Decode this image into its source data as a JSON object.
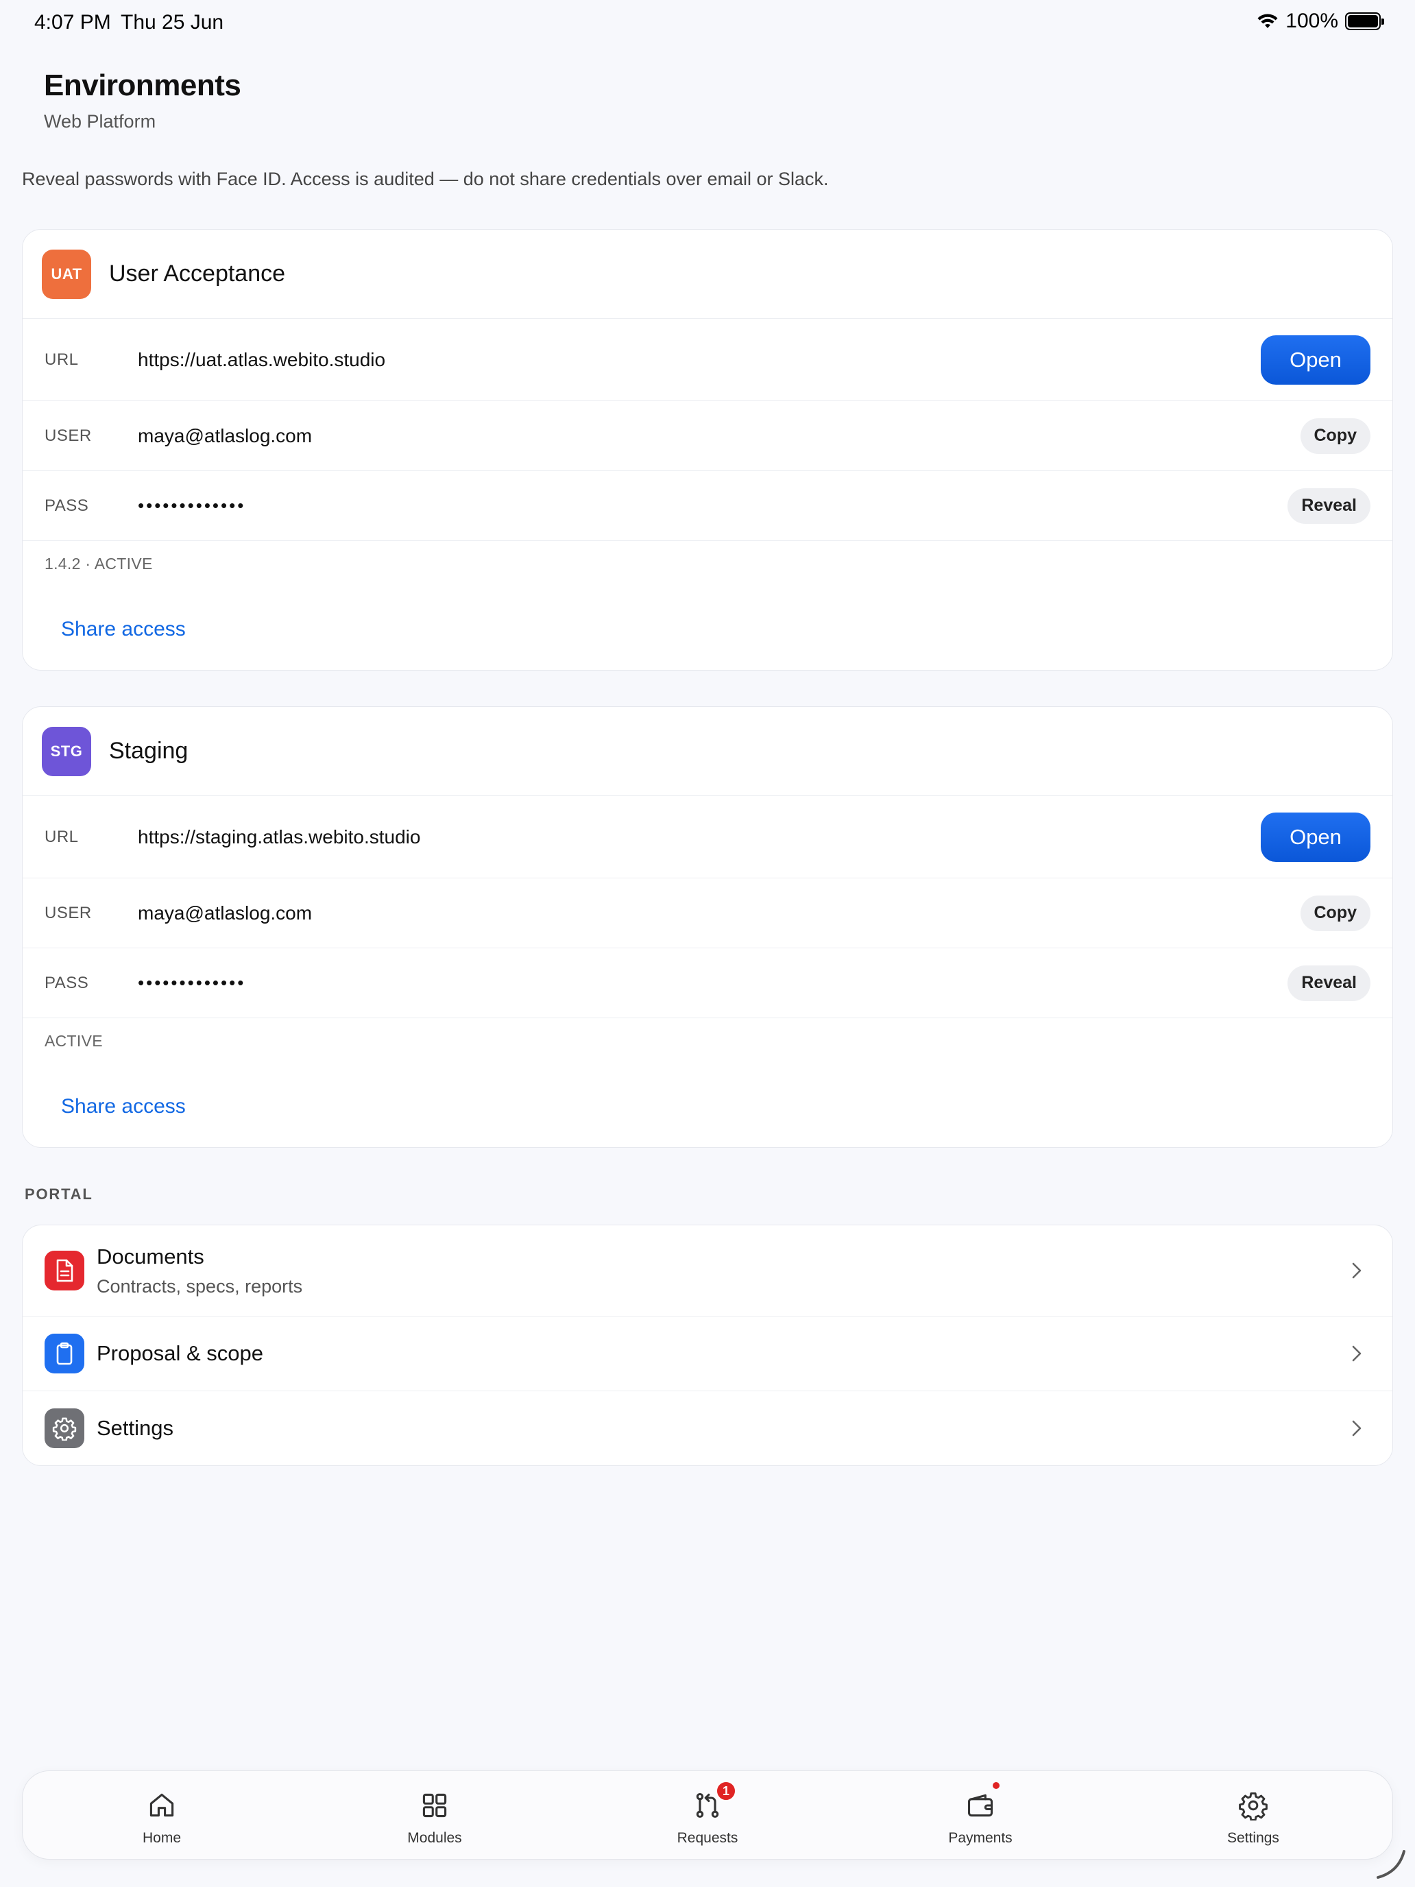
{
  "status_bar": {
    "time": "4:07 PM",
    "date": "Thu 25 Jun",
    "battery": "100%"
  },
  "header": {
    "title": "Environments",
    "subtitle": "Web Platform"
  },
  "notice": "Reveal passwords with Face ID. Access is audited — do not share credentials over email or Slack.",
  "environments": [
    {
      "badge": "UAT",
      "badge_color": "#ee6f3d",
      "name": "User Acceptance",
      "url_label": "URL",
      "url": "https://uat.atlas.webito.studio",
      "open_label": "Open",
      "user_label": "USER",
      "user": "maya@atlaslog.com",
      "copy_label": "Copy",
      "pass_label": "PASS",
      "pass": "•••••••••••••",
      "reveal_label": "Reveal",
      "meta": "1.4.2 · ACTIVE",
      "share_label": "Share access"
    },
    {
      "badge": "STG",
      "badge_color": "#6e55d8",
      "name": "Staging",
      "url_label": "URL",
      "url": "https://staging.atlas.webito.studio",
      "open_label": "Open",
      "user_label": "USER",
      "user": "maya@atlaslog.com",
      "copy_label": "Copy",
      "pass_label": "PASS",
      "pass": "•••••••••••••",
      "reveal_label": "Reveal",
      "meta": "ACTIVE",
      "share_label": "Share access"
    }
  ],
  "portal": {
    "section_label": "PORTAL",
    "items": [
      {
        "title": "Documents",
        "subtitle": "Contracts, specs, reports",
        "icon": "document-icon",
        "color": "#e5282f"
      },
      {
        "title": "Proposal & scope",
        "icon": "clipboard-icon",
        "color": "#1f6ff0"
      },
      {
        "title": "Settings",
        "icon": "gear-icon",
        "color": "#6f7075"
      }
    ]
  },
  "tabbar": {
    "items": [
      {
        "label": "Home",
        "icon": "home-icon"
      },
      {
        "label": "Modules",
        "icon": "grid-icon"
      },
      {
        "label": "Requests",
        "icon": "git-pull-request-icon",
        "badge": "1"
      },
      {
        "label": "Payments",
        "icon": "wallet-icon"
      },
      {
        "label": "Settings",
        "icon": "gear-icon"
      }
    ]
  }
}
